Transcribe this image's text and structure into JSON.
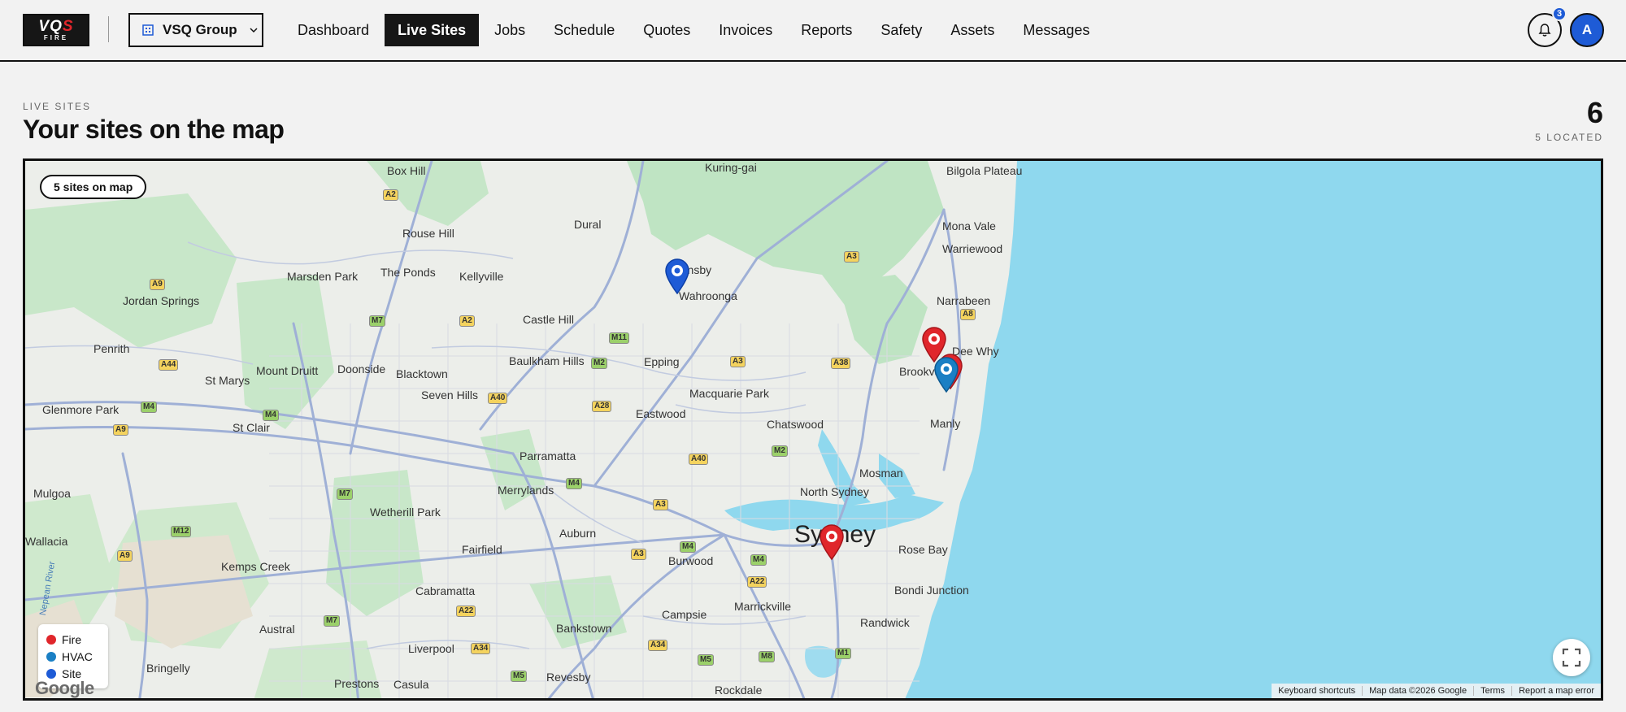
{
  "app": {
    "logo_text": "VQS FIRE"
  },
  "header": {
    "org_selector": "VSQ Group",
    "nav": [
      {
        "label": "Dashboard",
        "active": false
      },
      {
        "label": "Live Sites",
        "active": true
      },
      {
        "label": "Jobs",
        "active": false
      },
      {
        "label": "Schedule",
        "active": false
      },
      {
        "label": "Quotes",
        "active": false
      },
      {
        "label": "Invoices",
        "active": false
      },
      {
        "label": "Reports",
        "active": false
      },
      {
        "label": "Safety",
        "active": false
      },
      {
        "label": "Assets",
        "active": false
      },
      {
        "label": "Messages",
        "active": false
      }
    ],
    "notifications_count": "3",
    "avatar_initial": "A"
  },
  "page": {
    "eyebrow": "LIVE SITES",
    "title": "Your sites on the map",
    "site_count": "6",
    "located_label": "5 LOCATED"
  },
  "map": {
    "sites_badge": "5 sites on map",
    "legend": [
      {
        "label": "Fire",
        "color": "#e0262b"
      },
      {
        "label": "HVAC",
        "color": "#1a7fc4"
      },
      {
        "label": "Site",
        "color": "#1e5bd6"
      }
    ],
    "watermark": "Google",
    "attribution": [
      "Keyboard shortcuts",
      "Map data ©2026 Google",
      "Terms",
      "Report a map error"
    ],
    "place_labels": [
      "Box Hill",
      "Kuring-gai",
      "Bilgola Plateau",
      "Mona Vale",
      "Warriewood",
      "Rouse Hill",
      "Dural",
      "Marsden Park",
      "The Ponds",
      "Kellyville",
      "Hornsby",
      "Wahroonga",
      "Jordan Springs",
      "Narrabeen",
      "Castle Hill",
      "Penrith",
      "Mount Druitt",
      "Doonside",
      "Baulkham Hills",
      "Blacktown",
      "St Marys",
      "Seven Hills",
      "Epping",
      "Macquarie Park",
      "Dee Why",
      "Brookvale",
      "Glenmore Park",
      "Eastwood",
      "Chatswood",
      "Manly",
      "St Clair",
      "Parramatta",
      "Mosman",
      "Mulgoa",
      "Merrylands",
      "Wetherill Park",
      "North Sydney",
      "Sydney",
      "Rose Bay",
      "Wallacia",
      "Kemps Creek",
      "Fairfield",
      "Auburn",
      "Burwood",
      "Cabramatta",
      "Bondi Junction",
      "Campsie",
      "Marrickville",
      "Bankstown",
      "Randwick",
      "Austral",
      "Liverpool",
      "Bringelly",
      "Prestons",
      "Casula",
      "Revesby",
      "Rockdale",
      "Nepean River"
    ],
    "road_labels": [
      "A2",
      "A9",
      "M7",
      "A2",
      "A3",
      "M11",
      "A44",
      "M2",
      "A40",
      "A28",
      "A38",
      "A3",
      "A8",
      "M4",
      "M4",
      "A9",
      "M2",
      "A40",
      "M4",
      "M7",
      "M12",
      "A9",
      "A3",
      "A3",
      "M4",
      "M4",
      "A22",
      "A22",
      "M7",
      "A34",
      "A34",
      "M5",
      "M5",
      "M8",
      "M1"
    ]
  },
  "pins": [
    {
      "type": "Site",
      "color": "#1e5bd6"
    },
    {
      "type": "Fire",
      "color": "#e0262b"
    },
    {
      "type": "Fire",
      "color": "#e0262b"
    },
    {
      "type": "HVAC",
      "color": "#1a7fc4"
    },
    {
      "type": "Fire",
      "color": "#e0262b"
    }
  ]
}
